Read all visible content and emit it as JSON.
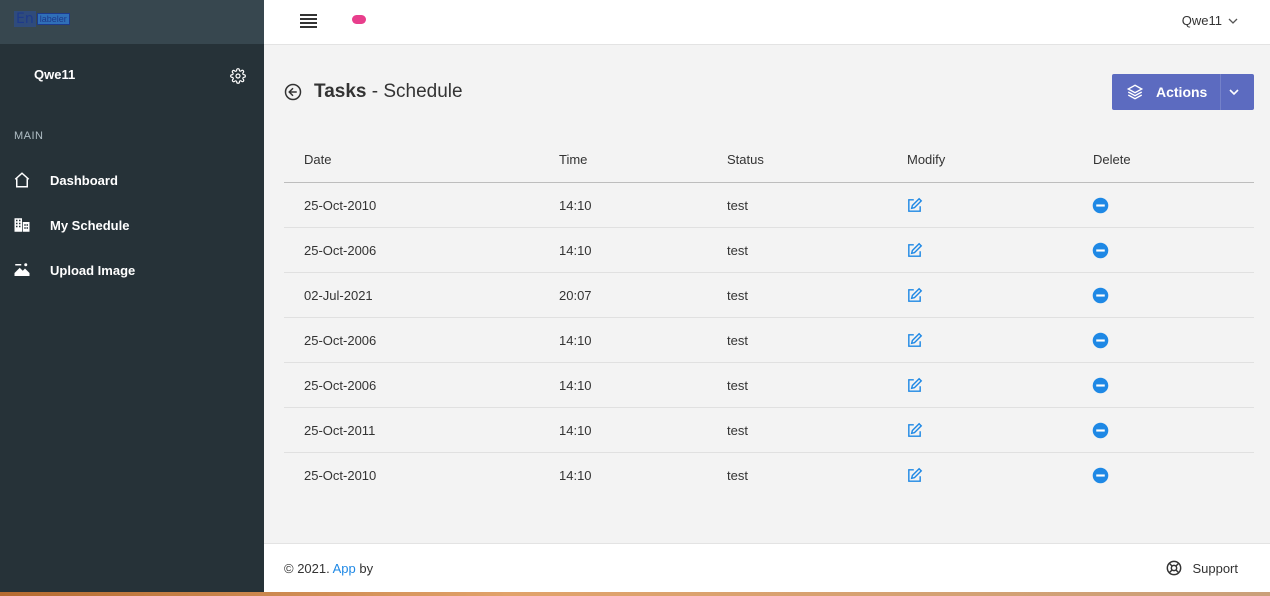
{
  "logo": {
    "part1": "En",
    "part2": "labeler"
  },
  "sidebar": {
    "user_name": "Qwe11",
    "section_label": "MAIN",
    "items": [
      {
        "label": "Dashboard",
        "icon": "home-icon"
      },
      {
        "label": "My Schedule",
        "icon": "building-icon"
      },
      {
        "label": "Upload Image",
        "icon": "upload-image-icon"
      }
    ]
  },
  "topbar": {
    "user_name": "Qwe11"
  },
  "page": {
    "title_bold": "Tasks",
    "title_rest": " - Schedule"
  },
  "actions": {
    "label": "Actions"
  },
  "table": {
    "headers": [
      "Date",
      "Time",
      "Status",
      "Modify",
      "Delete"
    ],
    "rows": [
      {
        "date": "25-Oct-2010",
        "time": "14:10",
        "status": "test"
      },
      {
        "date": "25-Oct-2006",
        "time": "14:10",
        "status": "test"
      },
      {
        "date": "02-Jul-2021",
        "time": "20:07",
        "status": "test"
      },
      {
        "date": "25-Oct-2006",
        "time": "14:10",
        "status": "test"
      },
      {
        "date": "25-Oct-2006",
        "time": "14:10",
        "status": "test"
      },
      {
        "date": "25-Oct-2011",
        "time": "14:10",
        "status": "test"
      },
      {
        "date": "25-Oct-2010",
        "time": "14:10",
        "status": "test"
      }
    ]
  },
  "footer": {
    "copyright": "© 2021. ",
    "link": "App",
    "by": " by",
    "support": "Support"
  },
  "colors": {
    "sidebar": "#263238",
    "accent": "#5c6bc0",
    "link": "#1e88e5",
    "pill": "#e83e8c"
  }
}
